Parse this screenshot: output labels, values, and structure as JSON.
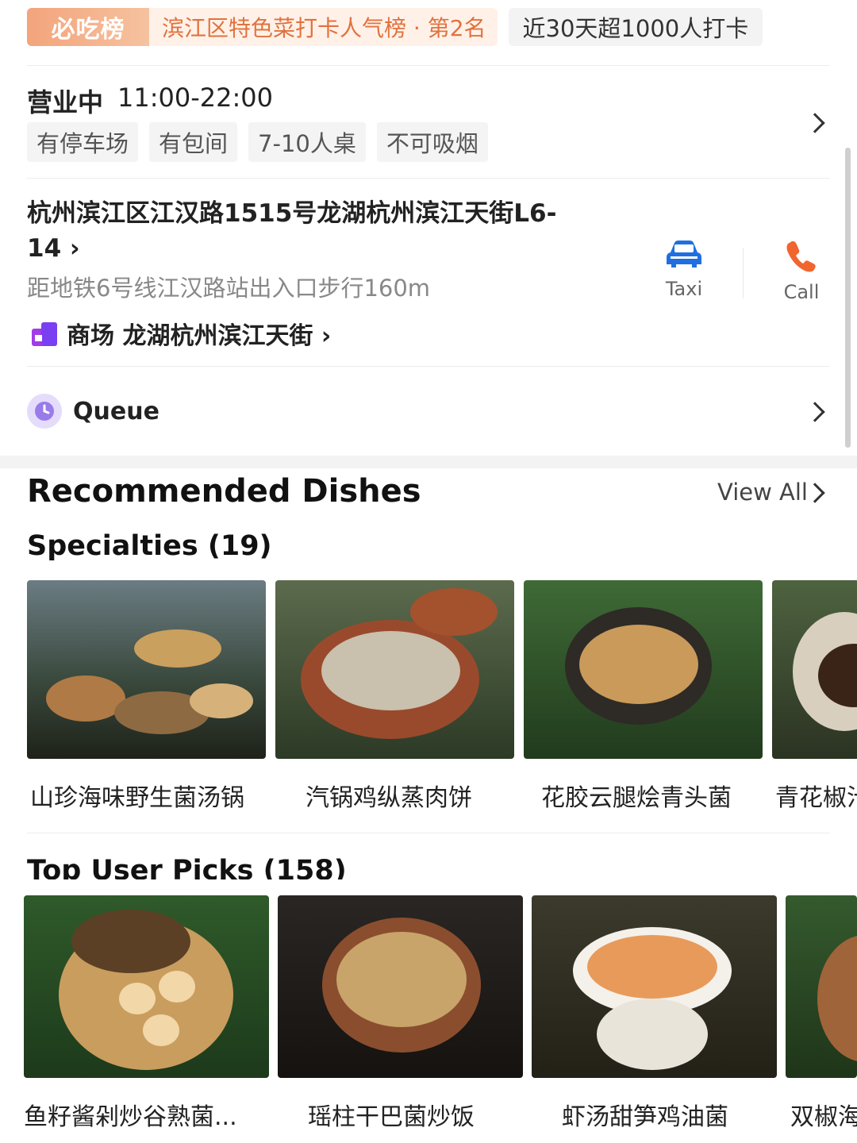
{
  "badges": {
    "rank_label": "必吃榜",
    "rank_text": "滨江区特色菜打卡人气榜 · 第2名",
    "rank_chevron": "›",
    "checkin_text": "近30天超1000人打卡"
  },
  "hours": {
    "status": "营业中",
    "time": "11:00-22:00"
  },
  "tags": [
    "有停车场",
    "有包间",
    "7-10人桌",
    "不可吸烟"
  ],
  "address": {
    "line": "杭州滨江区江汉路1515号龙湖杭州滨江天街L6-14 ›",
    "subway": "距地铁6号线江汉路站出入口步行160m",
    "mall_label": "商场  龙湖杭州滨江天街 ›"
  },
  "actions": {
    "taxi": "Taxi",
    "call": "Call"
  },
  "queue": {
    "label": "Queue"
  },
  "recommended": {
    "title": "Recommended Dishes",
    "view_all": "View All",
    "specialties": {
      "title": "Specialties (19)",
      "dishes": [
        "山珍海味野生菌汤锅",
        "汽锅鸡纵蒸肉饼",
        "花胶云腿烩青头菌",
        "青花椒汁"
      ]
    },
    "user_picks": {
      "title": "Top User Picks (158)",
      "dishes": [
        "鱼籽酱剁炒谷熟菌...",
        "瑶柱干巴菌炒饭",
        "虾汤甜笋鸡油菌",
        "双椒海"
      ]
    }
  },
  "colors": {
    "accent_orange": "#e0723e",
    "taxi_blue": "#1f6fe0",
    "call_orange": "#f0662e",
    "queue_purple": "#9a7bea"
  }
}
